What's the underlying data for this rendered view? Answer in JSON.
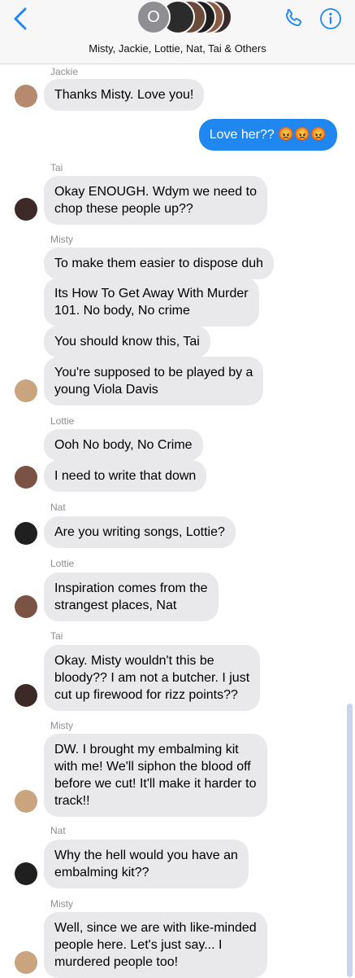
{
  "header": {
    "group_initial": "O",
    "title": "Misty, Jackie, Lottie, Nat, Tai & Others"
  },
  "messages": [
    {
      "sender": "Jackie",
      "text": "Thanks Misty. Love you!"
    },
    {
      "text": "Love her?? 😡😡😡",
      "outgoing": true
    },
    {
      "sender": "Tai",
      "text": [
        "Okay ENOUGH. Wdym we need to",
        "chop these people up??"
      ]
    },
    {
      "sender": "Misty",
      "text": "To make them easier to dispose duh"
    },
    {
      "text": [
        "Its How To Get Away With Murder",
        "101. No body, No crime"
      ]
    },
    {
      "text": "You should know this, Tai"
    },
    {
      "text": [
        "You're supposed to be played by a",
        "young Viola Davis"
      ]
    },
    {
      "sender": "Lottie",
      "text": "Ooh No body, No Crime"
    },
    {
      "text": "I need to write that down"
    },
    {
      "sender": "Nat",
      "text": "Are you writing songs, Lottie?"
    },
    {
      "sender": "Lottie",
      "text": [
        "Inspiration comes from the",
        "strangest places, Nat"
      ]
    },
    {
      "sender": "Tai",
      "text": [
        "Okay. Misty wouldn't this be",
        "bloody?? I am not a butcher. I just",
        "cut up firewood for rizz points??"
      ]
    },
    {
      "sender": "Misty",
      "text": [
        "DW. I brought my embalming kit",
        "with me! We'll siphon the blood off",
        "before we cut! It'll make it harder to",
        "track!!"
      ]
    },
    {
      "sender": "Nat",
      "text": [
        "Why the hell would you have an",
        "embalming kit??"
      ]
    },
    {
      "sender": "Misty",
      "text": [
        "Well, since we are with like-minded",
        "people here. Let's just say... I",
        "murdered people too!"
      ]
    }
  ],
  "colors": {
    "accent": "#1f87ef",
    "incoming_bubble": "#e9e9eb",
    "header_bg": "#f7f7f8"
  },
  "icons": [
    "back-chevron-icon",
    "phone-icon",
    "info-icon"
  ]
}
